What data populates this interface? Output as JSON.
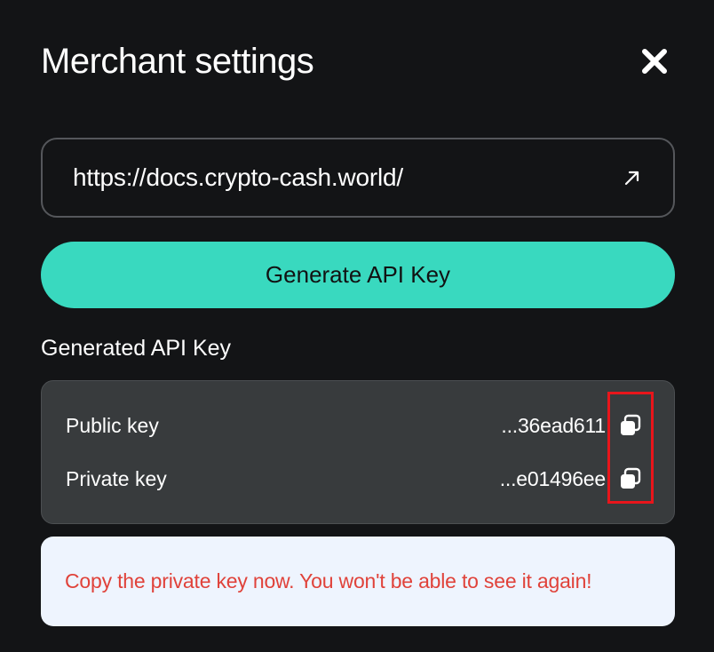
{
  "modal": {
    "title": "Merchant settings",
    "close_icon": "close-icon"
  },
  "docs": {
    "url": "https://docs.crypto-cash.world/",
    "link_icon": "external-link-arrow-icon"
  },
  "generate_button": {
    "label": "Generate API Key"
  },
  "api_keys": {
    "section_label": "Generated API Key",
    "public": {
      "label": "Public key",
      "value": "...36ead611",
      "copy_icon": "copy-icon"
    },
    "private": {
      "label": "Private key",
      "value": "...e01496ee",
      "copy_icon": "copy-icon"
    }
  },
  "warning": {
    "text": "Copy the private key now. You won't be able to see it again!"
  },
  "colors": {
    "background": "#131416",
    "accent": "#39d9bf",
    "card": "#383b3d",
    "warning_bg": "#eef4fe",
    "warning_text": "#e0423a",
    "highlight": "#e8151b"
  }
}
